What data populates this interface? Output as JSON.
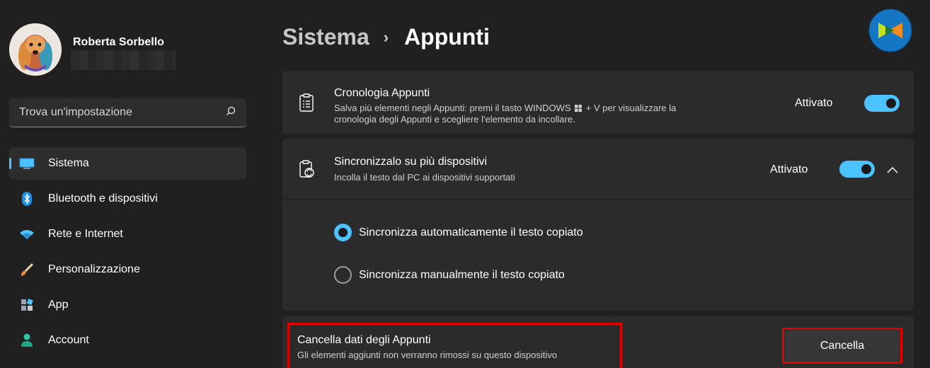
{
  "user": {
    "name": "Roberta Sorbello",
    "email": ""
  },
  "search": {
    "placeholder": "Trova un'impostazione"
  },
  "sidebar": {
    "items": [
      {
        "label": "Sistema",
        "icon": "system-display-icon",
        "active": true
      },
      {
        "label": "Bluetooth e dispositivi",
        "icon": "bluetooth-icon"
      },
      {
        "label": "Rete e Internet",
        "icon": "wifi-icon"
      },
      {
        "label": "Personalizzazione",
        "icon": "brush-icon"
      },
      {
        "label": "App",
        "icon": "apps-icon"
      },
      {
        "label": "Account",
        "icon": "account-icon"
      }
    ]
  },
  "header": {
    "parent": "Sistema",
    "separator": "›",
    "current": "Appunti"
  },
  "cards": {
    "history": {
      "title": "Cronologia Appunti",
      "desc_1": "Salva più elementi negli Appunti: premi il tasto WINDOWS",
      "desc_2": "+ V per visualizzare la",
      "desc_3": "cronologia degli Appunti e scegliere l'elemento da incollare.",
      "state": "Attivato"
    },
    "sync": {
      "title": "Sincronizzalo su più dispositivi",
      "desc": "Incolla il testo dal PC ai dispositivi supportati",
      "state": "Attivato",
      "options": [
        {
          "label": "Sincronizza automaticamente il testo copiato",
          "selected": true
        },
        {
          "label": "Sincronizza manualmente il testo copiato",
          "selected": false
        }
      ]
    },
    "clear": {
      "title": "Cancella dati degli Appunti",
      "desc": "Gli elementi aggiunti non verranno rimossi su questo dispositivo",
      "button": "Cancella"
    }
  },
  "colors": {
    "accent": "#4cc2ff",
    "highlight": "#e00000",
    "background": "#202020",
    "card": "#2b2b2b"
  }
}
